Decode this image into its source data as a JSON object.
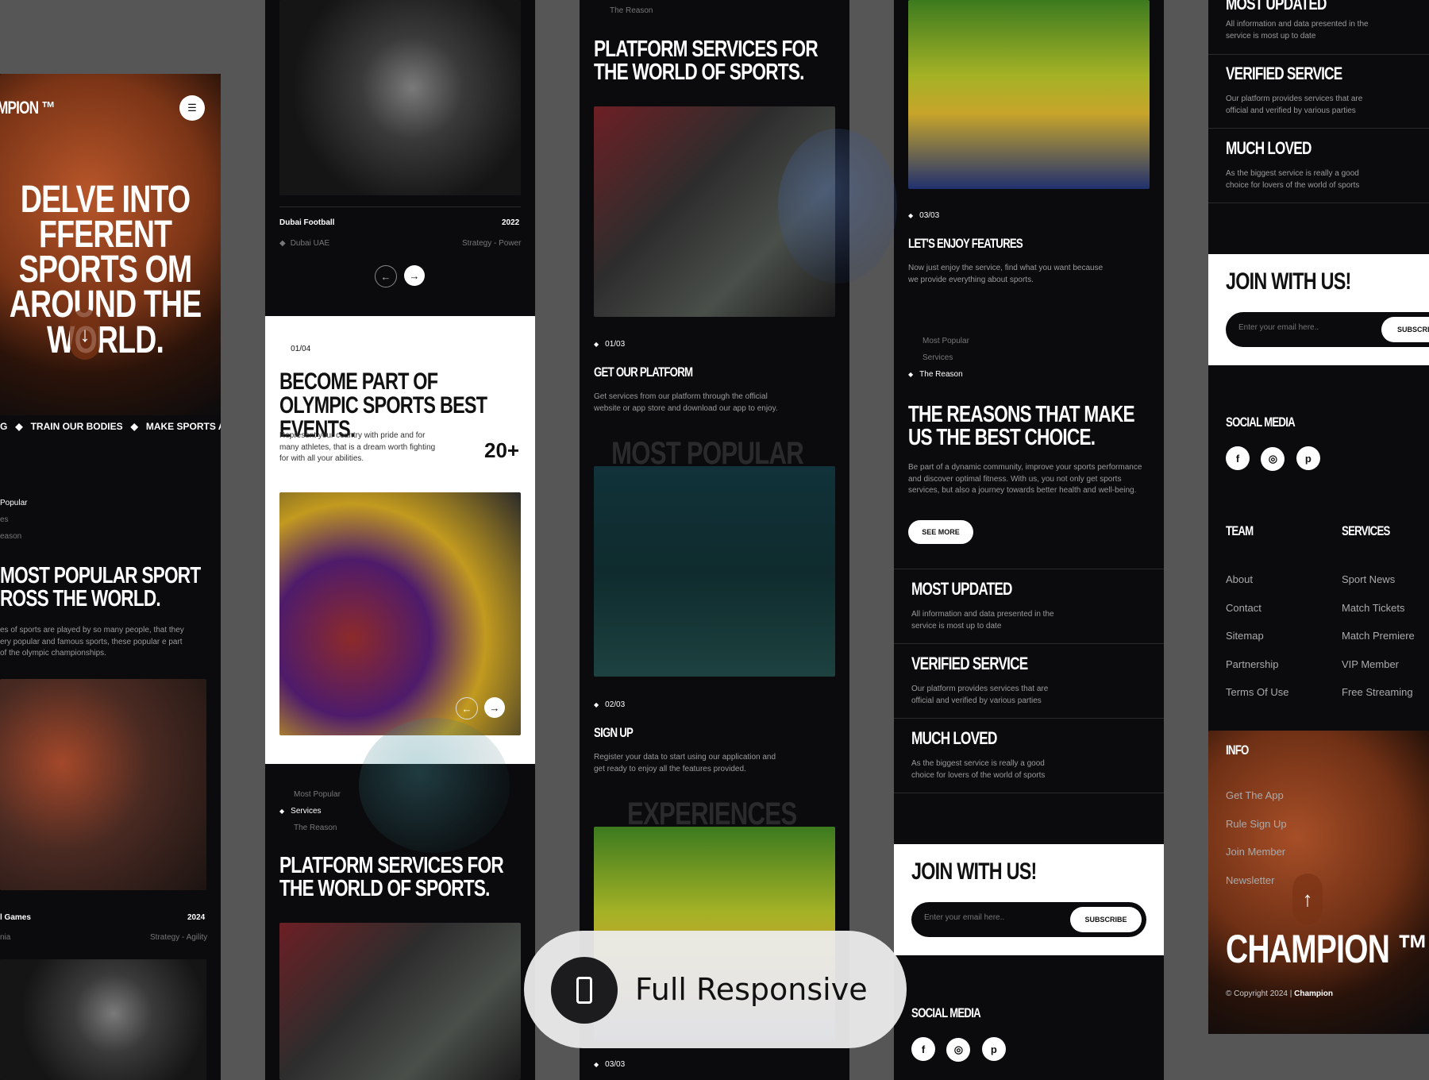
{
  "col1": {
    "brand": "MPION ™",
    "hero_title": "DELVE INTO FFERENT SPORTS OM AROUND THE WORLD.",
    "marquee": [
      "G",
      "TRAIN OUR BODIES",
      "MAKE SPORTS AS A F"
    ],
    "nav_items": [
      "Popular",
      "es",
      "eason"
    ],
    "section_title": "MOST POPULAR SPORT ROSS THE WORLD.",
    "section_text": "es of sports are played by so many people, that they ery popular and famous sports, these popular e part of the olympic championships.",
    "card_title": "l Games",
    "card_year": "2024",
    "card_loc": "nia",
    "card_tags": "Strategy - Agility"
  },
  "col2": {
    "card_title": "Dubai Football",
    "card_year": "2022",
    "card_loc": "Dubai UAE",
    "card_tags": "Strategy - Power",
    "counter": "01/04",
    "section_title": "BECOME PART OF OLYMPIC SPORTS BEST EVENTS.",
    "section_text": "Represent your country with pride and for many athletes, that is a dream worth fighting for with all your abilities.",
    "stat": "20+",
    "nav_items": [
      "Most Popular",
      "Services",
      "The Reason"
    ],
    "platform_title": "PLATFORM SERVICES FOR THE WORLD OF SPORTS."
  },
  "col3": {
    "top_label": "The Reason",
    "title": "PLATFORM SERVICES FOR THE WORLD OF SPORTS.",
    "step1_counter": "01/03",
    "step1_title": "GET OUR PLATFORM",
    "step1_text": "Get services from our platform through the official website or app store and download our app to enjoy.",
    "watermark1": "MOST POPULAR",
    "step2_counter": "02/03",
    "step2_title": "SIGN UP",
    "step2_text": "Register your data to start using our application and get ready to enjoy all the features provided.",
    "watermark2": "EXPERIENCES",
    "step3_counter": "03/03"
  },
  "col4": {
    "counter": "03/03",
    "feature_title": "LET'S ENJOY FEATURES",
    "feature_text": "Now just enjoy the service, find what you want because we provide everything about sports.",
    "nav_items": [
      "Most Popular",
      "Services",
      "The Reason"
    ],
    "reasons_title": "THE REASONS THAT MAKE US THE BEST CHOICE.",
    "reasons_text": "Be part of a dynamic community, improve your sports performance and discover optimal fitness. With us, you not only get sports services, but also a journey towards better health and well-being.",
    "see_more": "SEE MORE",
    "features": [
      {
        "title": "MOST UPDATED",
        "text": "All information and data presented in the service is most up to date"
      },
      {
        "title": "VERIFIED SERVICE",
        "text": "Our platform provides services that are official and verified by various parties"
      },
      {
        "title": "MUCH LOVED",
        "text": "As the biggest service is really a good choice for lovers of the world of sports"
      }
    ],
    "join_title": "JOIN WITH US!",
    "email_placeholder": "Enter your email here..",
    "subscribe": "SUBSCRIBE",
    "social_title": "SOCIAL MEDIA"
  },
  "col5": {
    "top_title": "MOST UPDATED",
    "top_text": "All information and data presented in the service is most up to date",
    "features": [
      {
        "title": "VERIFIED SERVICE",
        "text": "Our platform provides services that are official and verified by various parties"
      },
      {
        "title": "MUCH LOVED",
        "text": "As the biggest service is really a good choice for lovers of the world of sports"
      }
    ],
    "join_title": "JOIN WITH US!",
    "email_placeholder": "Enter your email here..",
    "subscribe": "SUBSCRI",
    "social_title": "SOCIAL MEDIA",
    "team_title": "TEAM",
    "team_links": [
      "About",
      "Contact",
      "Sitemap",
      "Partnership",
      "Terms Of Use"
    ],
    "services_title": "SERVICES",
    "services_links": [
      "Sport News",
      "Match Tickets",
      "Match Premiere",
      "VIP Member",
      "Free Streaming"
    ],
    "info_title": "INFO",
    "info_links": [
      "Get The App",
      "Rule Sign Up",
      "Join Member",
      "Newsletter"
    ],
    "brand": "CHAMPION ™",
    "copyright_prefix": "© Copyright 2024 |",
    "copyright_brand": "Champion"
  },
  "badge": {
    "label": "Full Responsive",
    "icon": "phone-icon"
  },
  "colors": {
    "background": "#565656",
    "panel": "#0b0b0d",
    "white": "#ffffff",
    "accent_blue": "#1f3b6e"
  }
}
